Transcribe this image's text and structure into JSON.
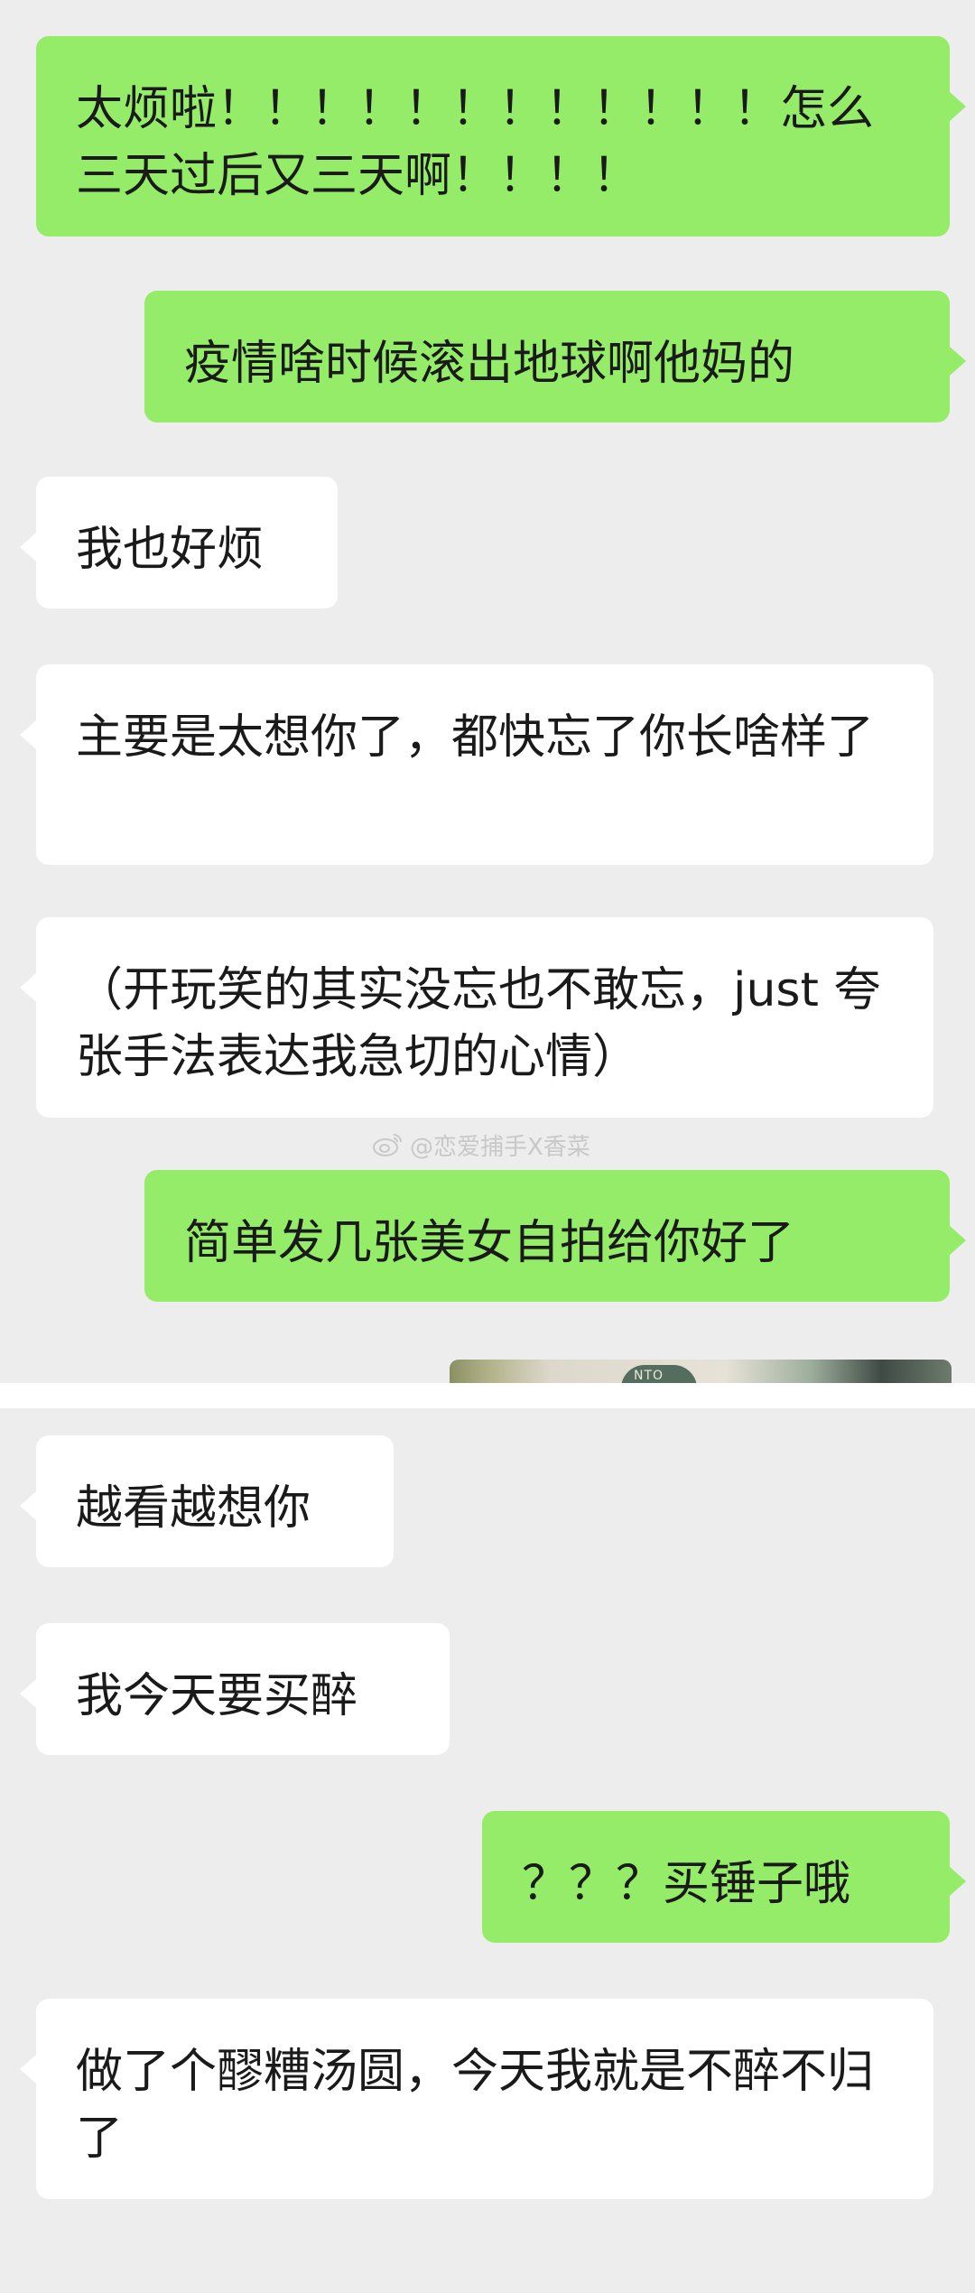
{
  "colors": {
    "background": "#ededed",
    "sent_bubble": "#95ec69",
    "received_bubble": "#ffffff",
    "text": "#1a1a1a"
  },
  "chat_top": {
    "messages": [
      {
        "from": "me",
        "text": "太烦啦！！！！！！！！！！！！怎么三天过后又三天啊！！！！"
      },
      {
        "from": "me",
        "text": "疫情啥时候滚出地球啊他妈的"
      },
      {
        "from": "other",
        "text": "我也好烦"
      },
      {
        "from": "other",
        "text": "主要是太想你了，都快忘了你长啥样了"
      },
      {
        "from": "other",
        "text": "（开玩笑的其实没忘也不敢忘，just 夸张手法表达我急切的心情）"
      },
      {
        "from": "me",
        "text": "简单发几张美女自拍给你好了"
      }
    ],
    "photo_peek_label": "NTO"
  },
  "watermark": {
    "icon": "weibo-icon",
    "text": "@恋爱捕手X香菜"
  },
  "chat_bottom": {
    "messages": [
      {
        "from": "other",
        "text": "越看越想你"
      },
      {
        "from": "other",
        "text": "我今天要买醉"
      },
      {
        "from": "me",
        "text": "？？？买锤子哦"
      },
      {
        "from": "other",
        "text": "做了个醪糟汤圆，今天我就是不醉不归了"
      }
    ]
  }
}
